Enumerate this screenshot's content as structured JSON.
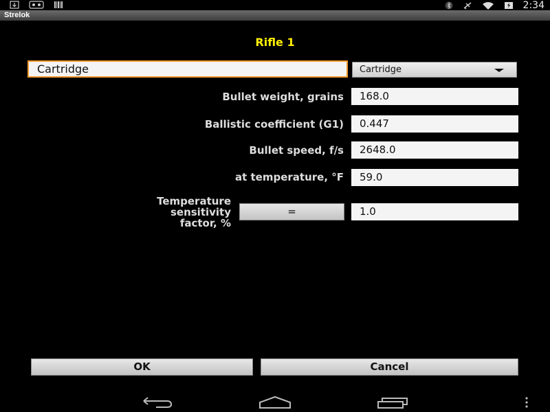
{
  "status_bar": {
    "left_icons": [
      "download-icon",
      "cat-icon",
      "barcode-icon"
    ],
    "right_icons": [
      "bluetooth-icon",
      "airplane-icon",
      "wifi-icon",
      "battery-icon"
    ],
    "time": "2:34"
  },
  "app": {
    "title": "Strelok"
  },
  "form": {
    "heading": "Rifle 1",
    "cartridge_name": "Cartridge",
    "cartridge_select": "Cartridge",
    "fields": [
      {
        "label": "Bullet weight, grains",
        "value": "168.0"
      },
      {
        "label": "Ballistic coefficient (G1)",
        "value": "0.447"
      },
      {
        "label": "Bullet speed, f/s",
        "value": "2648.0"
      },
      {
        "label": "at temperature, °F",
        "value": "59.0"
      }
    ],
    "temp_sensitivity": {
      "label_line1": "Temperature",
      "label_line2": "sensitivity",
      "label_line3": "factor, %",
      "button_label": "=",
      "value": "1.0"
    }
  },
  "buttons": {
    "ok": "OK",
    "cancel": "Cancel"
  },
  "navigation": [
    "back-icon",
    "home-icon",
    "recent-apps-icon",
    "menu-icon"
  ]
}
